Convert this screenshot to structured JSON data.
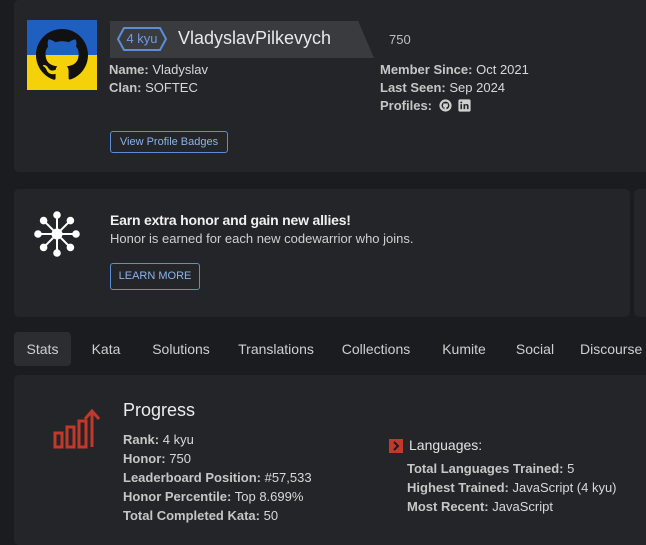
{
  "profile": {
    "rank": "4 kyu",
    "username": "VladyslavPilkevych",
    "honor": "750",
    "name_label": "Name:",
    "name_value": "Vladyslav",
    "clan_label": "Clan:",
    "clan_value": "SOFTEC",
    "member_since_label": "Member Since:",
    "member_since_value": "Oct 2021",
    "last_seen_label": "Last Seen:",
    "last_seen_value": "Sep 2024",
    "profiles_label": "Profiles:",
    "profile_icons": [
      "github-icon",
      "linkedin-icon"
    ],
    "badges_button": "View Profile Badges",
    "avatar_colors": {
      "top": "#1f5fbf",
      "bottom": "#f5d10a",
      "octocat": "#111111"
    }
  },
  "banner": {
    "title": "Earn extra honor and gain new allies!",
    "subtitle": "Honor is earned for each new codewarrior who joins.",
    "button": "LEARN MORE",
    "icon": "allies-network-icon"
  },
  "tabs": [
    {
      "label": "Stats",
      "active": true
    },
    {
      "label": "Kata",
      "active": false
    },
    {
      "label": "Solutions",
      "active": false
    },
    {
      "label": "Translations",
      "active": false
    },
    {
      "label": "Collections",
      "active": false
    },
    {
      "label": "Kumite",
      "active": false
    },
    {
      "label": "Social",
      "active": false
    },
    {
      "label": "Discourse",
      "active": false
    }
  ],
  "progress": {
    "title": "Progress",
    "icon": "progress-chart-icon",
    "rank_label": "Rank:",
    "rank_value": "4 kyu",
    "honor_label": "Honor:",
    "honor_value": "750",
    "leaderboard_label": "Leaderboard Position:",
    "leaderboard_value": "#57,533",
    "percentile_label": "Honor Percentile:",
    "percentile_value": "Top 8.699%",
    "completed_label": "Total Completed Kata:",
    "completed_value": "50"
  },
  "languages": {
    "heading": "Languages:",
    "total_label": "Total Languages Trained:",
    "total_value": "5",
    "highest_label": "Highest Trained:",
    "highest_value": "JavaScript (4 kyu)",
    "recent_label": "Most Recent:",
    "recent_value": "JavaScript"
  },
  "colors": {
    "background": "#1b1c1f",
    "panel": "#242528",
    "accent_blue": "#5b8ed6",
    "accent_red": "#c0392b"
  }
}
